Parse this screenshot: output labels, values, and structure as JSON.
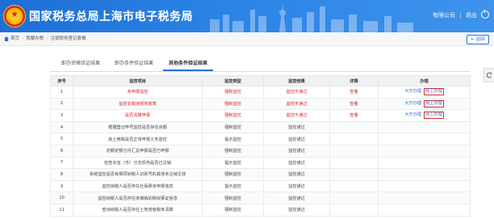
{
  "header": {
    "title": "国家税务总局上海市电子税务局",
    "company_link": "有限公司",
    "separator": "|",
    "exit_label": "退出"
  },
  "breadcrumb": {
    "items": [
      "首页",
      "我要办税",
      "注销税务登记套餐"
    ],
    "back_label": "返回"
  },
  "tabs": [
    {
      "label": "即办资格验证结果",
      "active": false
    },
    {
      "label": "即办条件验证结果",
      "active": false
    },
    {
      "label": "其他条件验证结果",
      "active": true
    }
  ],
  "table": {
    "headers": [
      "序号",
      "监控项目",
      "监控类型",
      "监控结果",
      "详情",
      "办理"
    ],
    "rows": [
      {
        "no": "1",
        "item": "未申报监控",
        "type": "强制监控",
        "result": "监控不通过",
        "detail": "查看",
        "hall": "大厅办理",
        "online": "网上办理",
        "alert": true
      },
      {
        "no": "2",
        "item": "监控非税违规类报表",
        "type": "强制监控",
        "result": "监控不通过",
        "detail": "查看",
        "hall": "大厅办理",
        "online": "网上办理",
        "alert": true
      },
      {
        "no": "3",
        "item": "是否清算申报",
        "type": "强制监控",
        "result": "监控不通过",
        "detail": "查看",
        "hall": "大厅办理",
        "online": "网上办理",
        "alert": true
      },
      {
        "no": "4",
        "item": "根据登记申号监控是否存在余额",
        "type": "强制监控",
        "result": "监控通过",
        "detail": "",
        "hall": "",
        "online": "",
        "alert": false
      },
      {
        "no": "5",
        "item": "房土两税是否正常申报义务监控",
        "type": "提示监控",
        "result": "监控通过",
        "detail": "",
        "hall": "",
        "online": "",
        "alert": false
      },
      {
        "no": "6",
        "item": "定期定额分月汇总申报是否已申报",
        "type": "强制监控",
        "result": "监控通过",
        "detail": "",
        "hall": "",
        "online": "",
        "alert": false
      },
      {
        "no": "7",
        "item": "检查本省（市）分支机构是否已注销",
        "type": "提示监控",
        "result": "监控通过",
        "detail": "",
        "hall": "",
        "online": "",
        "alert": false
      },
      {
        "no": "8",
        "item": "系统监控是否有相同纳税人识别号的其他未注销主体",
        "type": "强制监控",
        "result": "监控通过",
        "detail": "",
        "hall": "",
        "online": "",
        "alert": false
      },
      {
        "no": "9",
        "item": "监控纳税人是否存在社保费未申报信息",
        "type": "提示监控",
        "result": "监控通过",
        "detail": "",
        "hall": "",
        "online": "",
        "alert": false
      },
      {
        "no": "10",
        "item": "监控纳税人是否存在未缴销的税收票证信息",
        "type": "强制监控",
        "result": "监控通过",
        "detail": "",
        "hall": "",
        "online": "",
        "alert": false
      },
      {
        "no": "11",
        "item": "查询纳税人是否存在土地增值税未清算",
        "type": "强制监控",
        "result": "监控通过",
        "detail": "",
        "hall": "",
        "online": "",
        "alert": false
      }
    ]
  },
  "colors": {
    "header_blue": "#2b83e6",
    "alert_red": "#e02020",
    "link_blue": "#2b6fcf"
  },
  "icons": [
    "emblem-logo",
    "power-icon",
    "home-icon",
    "back-arrow-icon",
    "refresh-icon"
  ]
}
